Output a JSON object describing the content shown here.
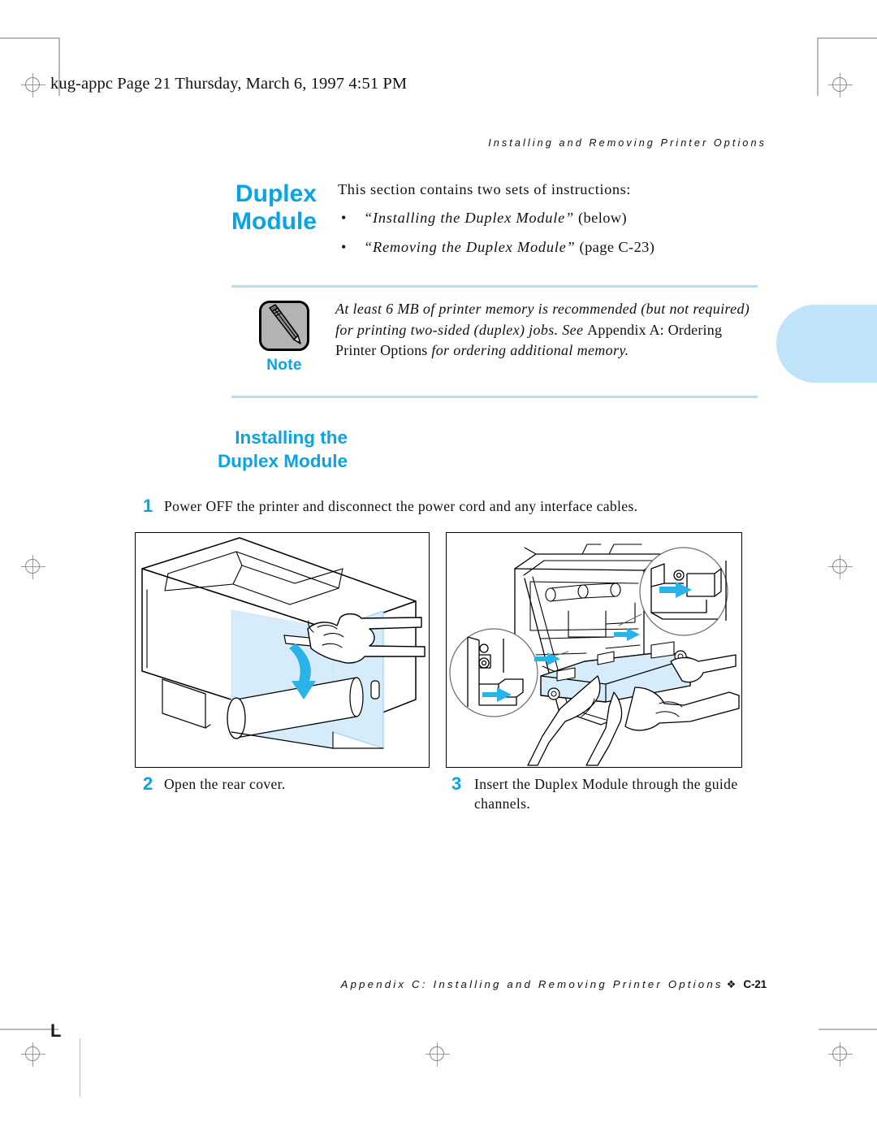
{
  "print_marks": {
    "corner_mark": "L"
  },
  "filestamp": "kug-appc  Page 21  Thursday, March 6, 1997  4:51 PM",
  "running_header": "Installing and Removing Printer Options",
  "section": {
    "side_title_line1": "Duplex",
    "side_title_line2": "Module",
    "intro_lead": "This section contains two sets of instructions:",
    "bullets": [
      {
        "marker": "•",
        "quoted": "“Installing the Duplex Module”",
        "suffix": " (below)"
      },
      {
        "marker": "•",
        "quoted": "“Removing the Duplex Module”",
        "suffix": " (page C-23)"
      }
    ]
  },
  "note": {
    "icon_name": "pencil-icon",
    "label": "Note",
    "text_part1": "At least 6 MB of printer memory is recommended (but not required) for printing two-sided (duplex) jobs. See ",
    "text_part2": "Appendix A: Ordering Printer Options",
    "text_part3": " for ordering additional memory."
  },
  "heading": {
    "line1": "Installing the",
    "line2": "Duplex Module"
  },
  "steps": [
    {
      "number": "1",
      "text": "Power OFF the printer and disconnect the power cord and any interface cables."
    },
    {
      "number": "2",
      "text": "Open the rear cover."
    },
    {
      "number": "3",
      "text": "Insert the Duplex Module through the guide channels."
    }
  ],
  "figures": [
    {
      "name": "printer-rear-cover-open-figure",
      "caption_step": "2"
    },
    {
      "name": "duplex-module-insert-figure",
      "caption_step": "3"
    }
  ],
  "footer": {
    "text": "Appendix C: Installing and Removing Printer Options",
    "diamond": "❖",
    "page": "C-21"
  },
  "colors": {
    "accent_blue": "#0aa3e3",
    "rule_blue": "#b8dcf5",
    "tab_blue": "#bfe3fa",
    "art_highlight": "#d6ecfa",
    "art_arrow": "#29b3ea"
  }
}
